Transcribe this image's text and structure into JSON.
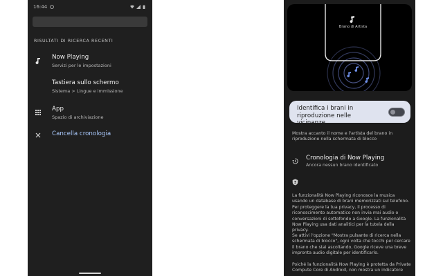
{
  "left_screen": {
    "status_time": "16:44",
    "section_header": "RISULTATI DI RICERCA RECENTI",
    "results": [
      {
        "icon": "music-note-icon",
        "title": "Now Playing",
        "subtitle": "Servizi per le impostazioni"
      },
      {
        "icon": "",
        "title": "Tastiera sullo schermo",
        "subtitle": "Sistema > Lingue e immissione"
      },
      {
        "icon": "apps-grid-icon",
        "title": "App",
        "subtitle": "Spazio di archiviazione"
      },
      {
        "icon": "close-icon",
        "title": "Cancella cronologia",
        "subtitle": ""
      }
    ]
  },
  "right_screen": {
    "hero": {
      "caption": "Brano di Artista"
    },
    "toggle": {
      "label": "Identifica i brani in riproduzione nelle vicinanze",
      "on": false
    },
    "toggle_description": "Mostra accanto il nome e l'artista del brano in riproduzione nella schermata di blocco",
    "history": {
      "title": "Cronologia di Now Playing",
      "subtitle": "Ancora nessun brano identificato"
    },
    "info_paragraphs": [
      "La funzionalità Now Playing riconosce la musica usando un database di brani memorizzati sul telefono. Per proteggere la tua privacy, il processo di riconoscimento automatico non invia mai audio o conversazioni di sottofondo a Google. La funzionalità Now Playing usa dati analitici per la tutela della privacy.",
      "Se attivi l'opzione \"Mostra pulsante di ricerca nella schermata di blocco\", ogni volta che tocchi per cercare il brano che stai ascoltando, Google riceve una breve impronta audio digitale per identificarlo.",
      "Poiché la funzionalità Now Playing è protetta da Private Compute Core di Android, non mostra un indicatore"
    ]
  },
  "colors": {
    "background": "#1f1f1f",
    "accent_link": "#a8c7fa",
    "card": "#dfe3ef",
    "note_blue": "#6f8fe8"
  }
}
